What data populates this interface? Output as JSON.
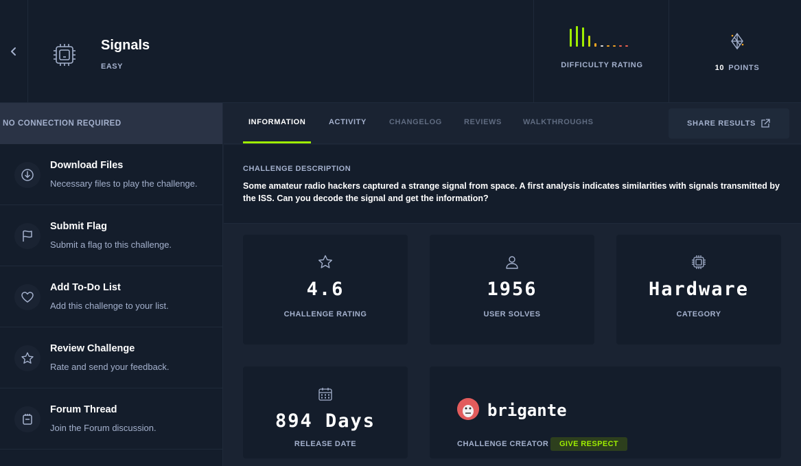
{
  "challenge": {
    "name": "Signals",
    "difficulty": "EASY"
  },
  "difficulty_rating": {
    "label": "DIFFICULTY RATING",
    "bar_colors": [
      "#9fef00",
      "#9fef00",
      "#9fef00",
      "#c5dc00",
      "#f5a623",
      "#e0e0e0",
      "#f5a623",
      "#f5a623",
      "#f06050",
      "#f06050"
    ]
  },
  "points": {
    "value": "10",
    "label": "POINTS"
  },
  "sidebar": {
    "connection": "NO CONNECTION REQUIRED",
    "actions": [
      {
        "title": "Download Files",
        "subtitle": "Necessary files to play the challenge.",
        "icon": "download-icon"
      },
      {
        "title": "Submit Flag",
        "subtitle": "Submit a flag to this challenge.",
        "icon": "flag-icon"
      },
      {
        "title": "Add To-Do List",
        "subtitle": "Add this challenge to your list.",
        "icon": "heart-icon"
      },
      {
        "title": "Review Challenge",
        "subtitle": "Rate and send your feedback.",
        "icon": "star-icon"
      },
      {
        "title": "Forum Thread",
        "subtitle": "Join the Forum discussion.",
        "icon": "forum-icon"
      }
    ]
  },
  "tabs": [
    {
      "label": "INFORMATION",
      "active": true
    },
    {
      "label": "ACTIVITY"
    },
    {
      "label": "CHANGELOG"
    },
    {
      "label": "REVIEWS"
    },
    {
      "label": "WALKTHROUGHS"
    }
  ],
  "share_label": "SHARE RESULTS",
  "description": {
    "heading": "CHALLENGE DESCRIPTION",
    "text": "Some amateur radio hackers captured a strange signal from space. A first analysis indicates similarities with signals transmitted by the ISS. Can you decode the signal and get the information?"
  },
  "stats": {
    "rating": {
      "value": "4.6",
      "label": "CHALLENGE RATING"
    },
    "solves": {
      "value": "1956",
      "label": "USER SOLVES"
    },
    "category": {
      "value": "Hardware",
      "label": "CATEGORY"
    },
    "release": {
      "value": "894 Days",
      "label": "RELEASE DATE"
    }
  },
  "creator": {
    "name": "brigante",
    "label": "CHALLENGE CREATOR",
    "respect_label": "GIVE RESPECT"
  },
  "colors": {
    "accent": "#9fef00",
    "background": "#1a2332",
    "panel": "#141d2b"
  }
}
